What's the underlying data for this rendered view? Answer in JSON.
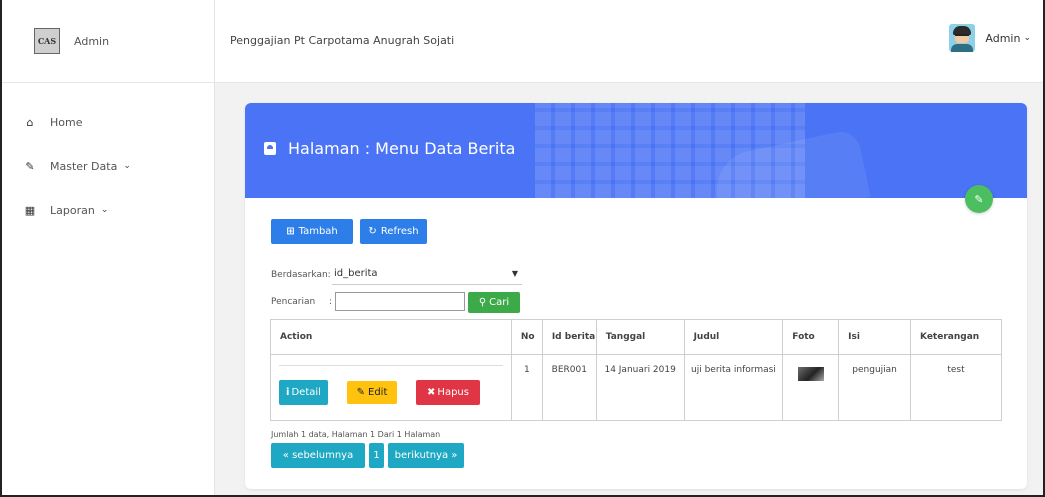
{
  "sidebar": {
    "logo_text": "CAS",
    "brand": "Admin",
    "items": [
      {
        "label": "Home",
        "icon": "home-icon"
      },
      {
        "label": "Master Data",
        "icon": "edit-icon"
      },
      {
        "label": "Laporan",
        "icon": "calendar-icon"
      }
    ]
  },
  "header": {
    "title": "Penggajian Pt Carpotama Anugrah Sojati",
    "user": "Admin"
  },
  "card": {
    "title": "Halaman : Menu Data Berita",
    "header_color": "#4a73f5"
  },
  "toolbar": {
    "tambah": "Tambah",
    "refresh": "Refresh"
  },
  "filter": {
    "sort_label": "Berdasarkan:",
    "sort_value": "id_berita",
    "search_label": "Pencarian",
    "search_value": "",
    "search_button": "Cari"
  },
  "table": {
    "headers": [
      "Action",
      "No",
      "Id berita",
      "Tanggal",
      "Judul",
      "Foto",
      "Isi",
      "Keterangan"
    ],
    "rows": [
      {
        "no": "1",
        "id": "BER001",
        "tanggal": "14 Januari 2019",
        "judul": "uji berita informasi",
        "isi": "pengujian",
        "keterangan": "test"
      }
    ],
    "actions": {
      "detail": "Detail",
      "edit": "Edit",
      "hapus": "Hapus"
    }
  },
  "pagination": {
    "info": "Jumlah 1 data, Halaman 1 Dari 1 Halaman",
    "prev": "« sebelumnya",
    "page": "1",
    "next": "berikutnya »"
  }
}
